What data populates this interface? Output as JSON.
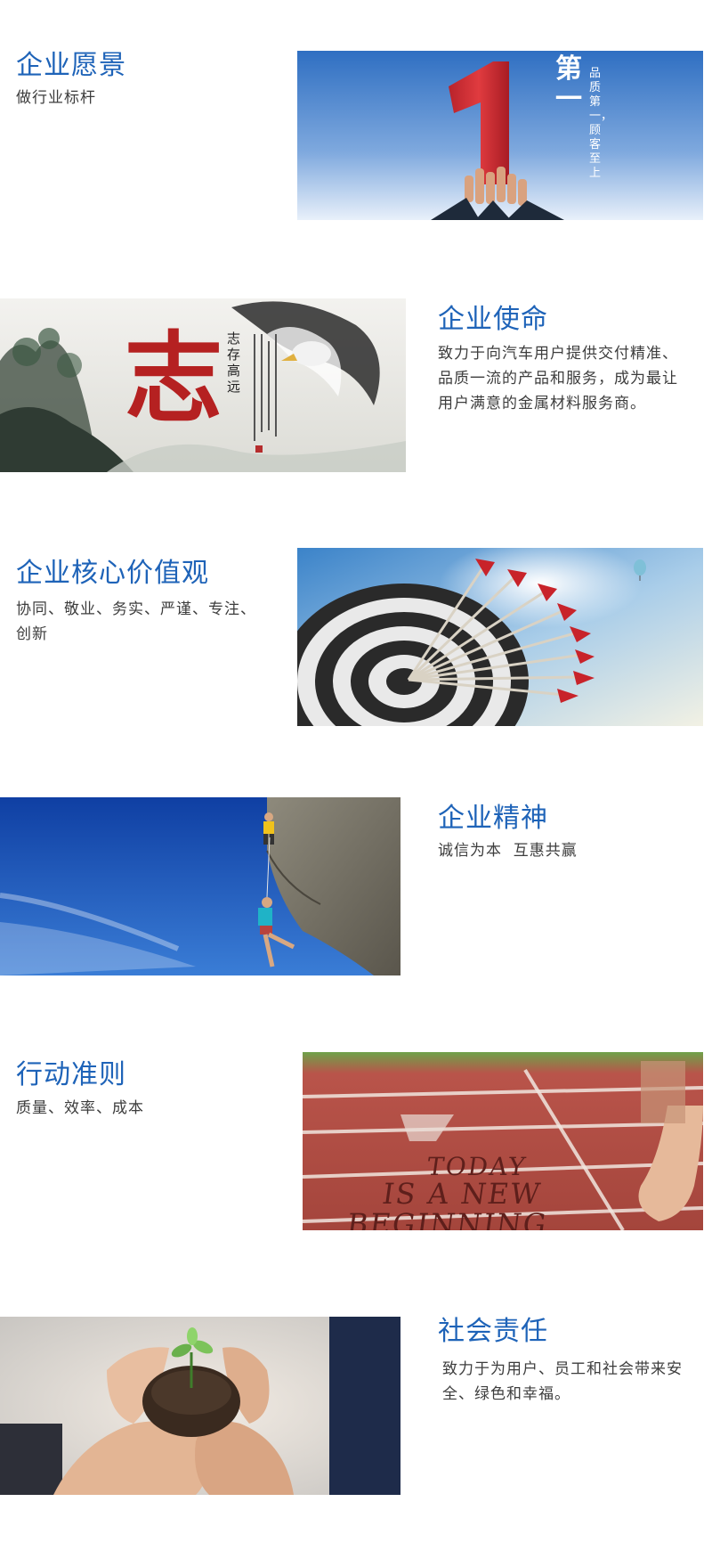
{
  "sections": [
    {
      "title": "企业愿景",
      "text": "做行业标杆",
      "image": {
        "subject": "raised-hands-number-one",
        "big_char": "第一",
        "vertical_text": "品质第一，顾客至上"
      }
    },
    {
      "title": "企业使命",
      "text": "致力于向汽车用户提供交付精准、品质一流的产品和服务，成为最让用户满意的金属材料服务商。",
      "image": {
        "subject": "ink-painting-eagle",
        "big_char": "志",
        "calligraphy": "志存高远"
      }
    },
    {
      "title": "企业核心价值观",
      "text": "协同、敬业、务实、严谨、专注、创新",
      "image": {
        "subject": "arrows-on-target"
      }
    },
    {
      "title": "企业精神",
      "text": "诚信为本  互惠共赢",
      "image": {
        "subject": "rock-climbers"
      }
    },
    {
      "title": "行动准则",
      "text": "质量、效率、成本",
      "image": {
        "subject": "running-track",
        "track_text_line1": "TODAY",
        "track_text_line2": "IS A NEW",
        "track_text_line3": "BEGINNING"
      }
    },
    {
      "title": "社会责任",
      "text": "致力于为用户、员工和社会带来安全、绿色和幸福。",
      "image": {
        "subject": "hands-holding-seedling"
      }
    }
  ],
  "colors": {
    "heading": "#1e63b8",
    "body": "#3d3d3d",
    "background": "#ffffff"
  }
}
